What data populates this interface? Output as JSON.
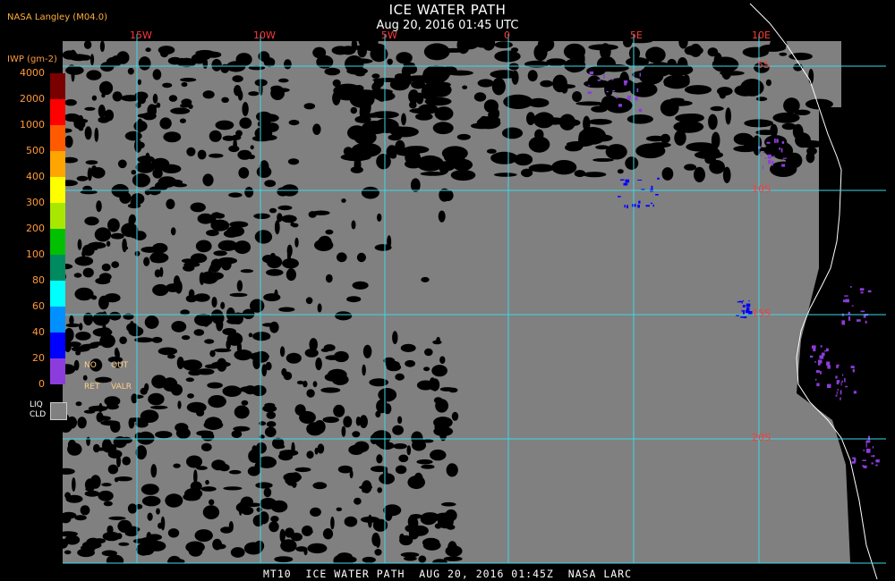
{
  "header": {
    "title": "ICE WATER PATH",
    "timestamp": "Aug 20, 2016 01:45 UTC",
    "provider": "NASA Langley (M04.0)"
  },
  "colorbar": {
    "unit": "IWP (gm-2)",
    "levels": [
      "4000",
      "2000",
      "1000",
      "500",
      "400",
      "300",
      "200",
      "100",
      "80",
      "60",
      "40",
      "20",
      "0"
    ],
    "colors": [
      "#7a0000",
      "#ff0000",
      "#ff5a00",
      "#ffa500",
      "#ffff00",
      "#a8e800",
      "#00c000",
      "#008a60",
      "#00ffff",
      "#0090ff",
      "#0000ff",
      "#8c3cdc"
    ],
    "no_ret": [
      "NO",
      "RET"
    ],
    "out_valr": [
      "OUT",
      "VALR"
    ],
    "liq": [
      "LIQ",
      "CLD"
    ],
    "liq_color": "#808080"
  },
  "grid": {
    "lon_labels": [
      "15W",
      "10W",
      "5W",
      "0",
      "5E",
      "10E"
    ],
    "lat_labels": [
      "5S",
      "10S",
      "15S",
      "20S"
    ],
    "grid_color": "#3ad8e8",
    "label_color": "#ff3a3a"
  },
  "footer": {
    "text": "MT10  ICE WATER PATH  AUG 20, 2016 01:45Z  NASA LARC"
  }
}
